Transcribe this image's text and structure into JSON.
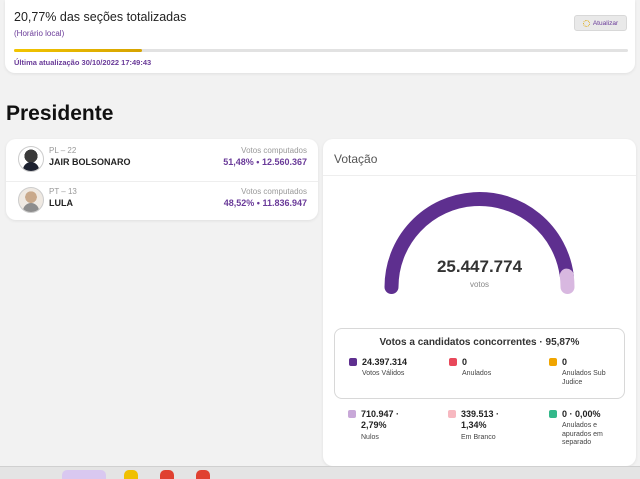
{
  "header": {
    "sections_title": "20,77% das seções totalizadas",
    "time_note": "(Horário local)",
    "progress_percent": 20.77,
    "last_update": "Última atualização 30/10/2022 17:49:43",
    "update_button": "Atualizar"
  },
  "section_title": "Presidente",
  "candidates": [
    {
      "party": "PL – 22",
      "name": "JAIR BOLSONARO",
      "votes_label": "Votos computados",
      "votes_value": "51,48% • 12.560.367"
    },
    {
      "party": "PT – 13",
      "name": "LULA",
      "votes_label": "Votos computados",
      "votes_value": "48,52% • 11.836.947"
    }
  ],
  "votacao": {
    "title": "Votação",
    "total": "25.447.774",
    "total_label": "votos",
    "gauge_share": {
      "validos_percent": 95.87,
      "colors": {
        "validos": "#5e2f8f",
        "other": "#d8b8e0"
      }
    },
    "box_title": "Votos a candidatos concorrentes · 95,87%",
    "stats": [
      {
        "value": "24.397.314",
        "label": "Votos Válidos",
        "color": "#5e2f8f"
      },
      {
        "value": "0",
        "label": "Anulados",
        "color": "#e8485a"
      },
      {
        "value": "0",
        "label": "Anulados Sub Judice",
        "color": "#f0a500"
      },
      {
        "value": "710.947 · 2,79%",
        "label": "Nulos",
        "color": "#c8a8d8"
      },
      {
        "value": "339.513 · 1,34%",
        "label": "Em Branco",
        "color": "#f7b8c0"
      },
      {
        "value": "0 · 0,00%",
        "label": "Anulados e apurados em separado",
        "color": "#33b88a"
      }
    ]
  }
}
